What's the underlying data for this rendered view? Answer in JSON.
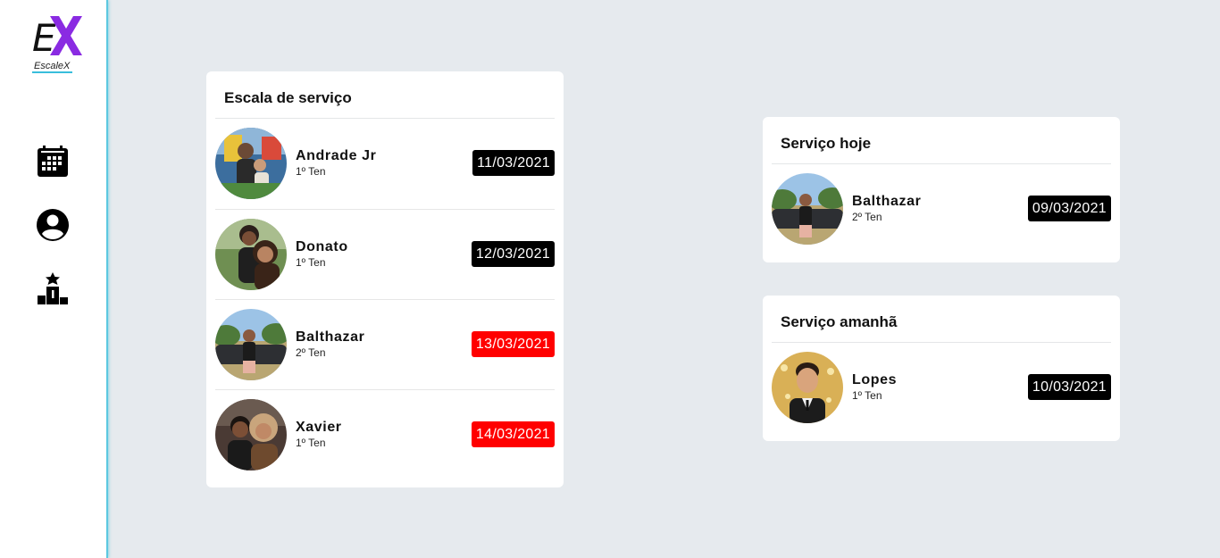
{
  "app": {
    "logo_e": "E",
    "name": "EscaleX",
    "accent": "#8a2be2",
    "underline": "#38bedc"
  },
  "nav": [
    {
      "icon": "calendar-icon"
    },
    {
      "icon": "account-circle-icon"
    },
    {
      "icon": "podium-ranking-icon"
    }
  ],
  "escala": {
    "title": "Escala de serviço",
    "rows": [
      {
        "name": "Andrade Jr",
        "rank": "1º Ten",
        "date": "11/03/2021",
        "status": "black"
      },
      {
        "name": "Donato",
        "rank": "1º Ten",
        "date": "12/03/2021",
        "status": "black"
      },
      {
        "name": "Balthazar",
        "rank": "2º Ten",
        "date": "13/03/2021",
        "status": "red"
      },
      {
        "name": "Xavier",
        "rank": "1º Ten",
        "date": "14/03/2021",
        "status": "red"
      }
    ]
  },
  "hoje": {
    "title": "Serviço hoje",
    "row": {
      "name": "Balthazar",
      "rank": "2º Ten",
      "date": "09/03/2021",
      "status": "black"
    }
  },
  "amanha": {
    "title": "Serviço amanhã",
    "row": {
      "name": "Lopes",
      "rank": "1º Ten",
      "date": "10/03/2021",
      "status": "black"
    }
  },
  "colors": {
    "badge_black": "#000000",
    "badge_red": "#ff0000",
    "background": "#e6eaee"
  }
}
